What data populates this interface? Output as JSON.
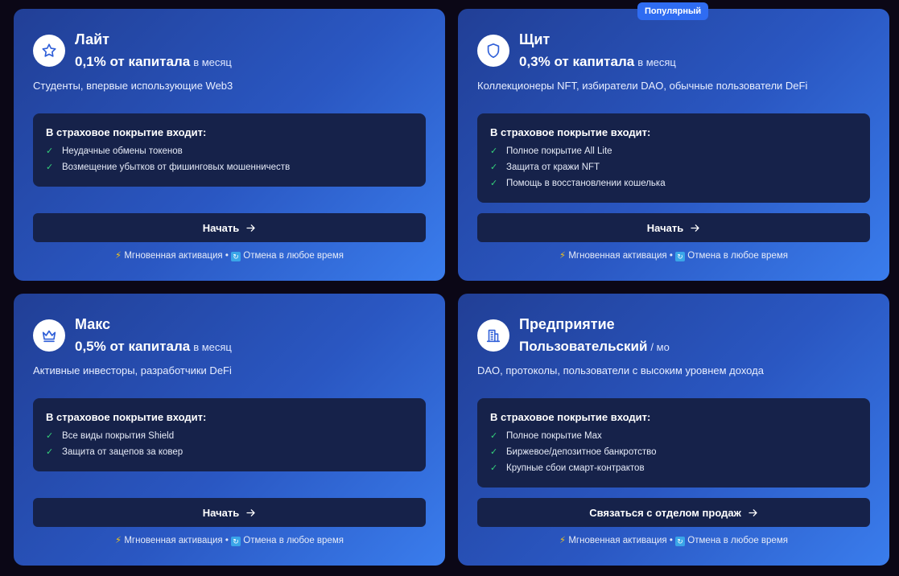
{
  "badge": "Популярный",
  "plans": [
    {
      "name": "Лайт",
      "price": "0,1% от капитала",
      "period": "в месяц",
      "audience": "Студенты, впервые использующие Web3",
      "coverage_title": "В страховое покрытие входит:",
      "features": [
        "Неудачные обмены токенов",
        "Возмещение убытков от фишинговых мошенничеств"
      ],
      "cta": "Начать",
      "icon": "star-icon"
    },
    {
      "name": "Щит",
      "price": "0,3% от капитала",
      "period": "в месяц",
      "audience": "Коллекционеры NFT, избиратели DAO, обычные пользователи DeFi",
      "coverage_title": "В страховое покрытие входит:",
      "features": [
        "Полное покрытие All Lite",
        "Защита от кражи NFT",
        "Помощь в восстановлении кошелька"
      ],
      "cta": "Начать",
      "icon": "shield-icon"
    },
    {
      "name": "Макс",
      "price": "0,5% от капитала",
      "period": "в месяц",
      "audience": "Активные инвесторы, разработчики DeFi",
      "coverage_title": "В страховое покрытие входит:",
      "features": [
        "Все виды покрытия Shield",
        "Защита от зацепов за ковер"
      ],
      "cta": "Начать",
      "icon": "crown-icon"
    },
    {
      "name": "Предприятие",
      "price": "Пользовательский",
      "period": "/ мо",
      "audience": "DAO, протоколы, пользователи с высоким уровнем дохода",
      "coverage_title": "В страховое покрытие входит:",
      "features": [
        "Полное покрытие Max",
        "Биржевое/депозитное банкротство",
        "Крупные сбои смарт-контрактов"
      ],
      "cta": "Связаться с отделом продаж",
      "icon": "building-icon"
    }
  ],
  "footnote": {
    "activation": "Мгновенная активация",
    "separator": "•",
    "cancel": "Отмена в любое время"
  },
  "colors": {
    "page_bg": "#0b0716",
    "card_gradient_start": "#213f96",
    "card_gradient_end": "#3a7ded",
    "panel_bg": "#16224a",
    "badge_bg": "#2f6cf2",
    "check": "#34d17a",
    "icon_stroke": "#2f5fd8"
  }
}
